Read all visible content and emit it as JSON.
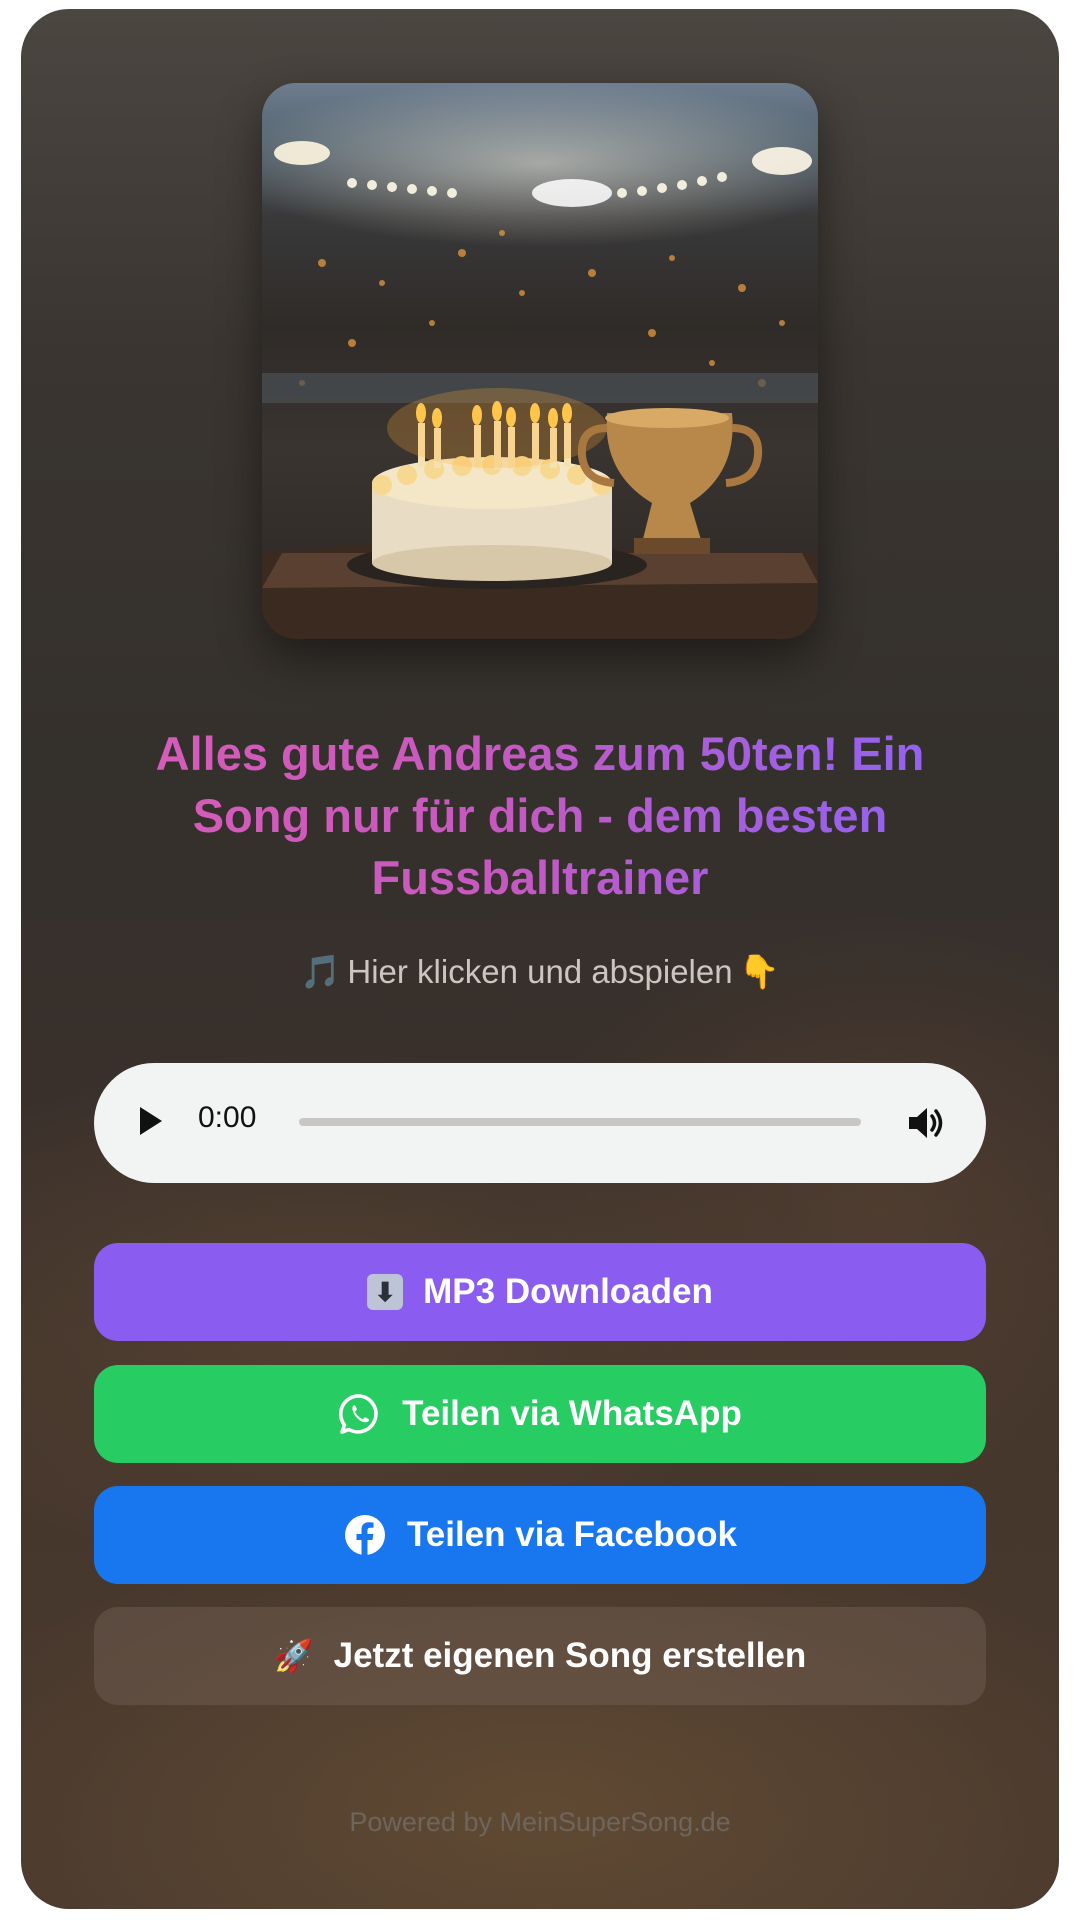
{
  "cover": {
    "icon": "birthday-cake-trophy-stadium-image",
    "alt": ""
  },
  "title": "Alles gute Andreas zum 50ten! Ein Song nur für dich - dem besten Fussballtrainer",
  "hint": {
    "note_icon": "🎵",
    "text": "Hier klicken und abspielen",
    "hand_icon": "👇"
  },
  "player": {
    "time": "0:00",
    "progress": 0,
    "play_icon": "play-icon",
    "volume_icon": "volume-icon"
  },
  "buttons": {
    "download": {
      "icon": "⬇",
      "label": "MP3 Downloaden",
      "color": "#8b5cf0"
    },
    "whatsapp": {
      "icon": "whatsapp-icon",
      "label": "Teilen via WhatsApp",
      "color": "#27cc62"
    },
    "facebook": {
      "icon": "facebook-icon",
      "label": "Teilen via Facebook",
      "color": "#1877ee"
    },
    "create": {
      "icon": "🚀",
      "label": "Jetzt eigenen Song erstellen"
    }
  },
  "footer": "Powered by MeinSuperSong.de"
}
